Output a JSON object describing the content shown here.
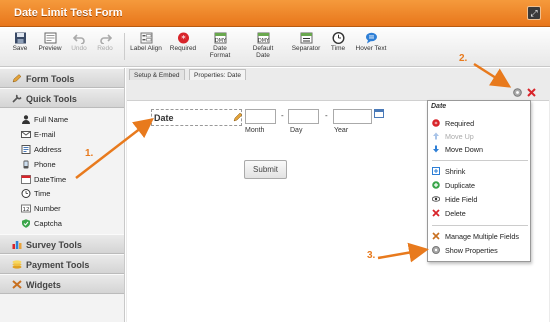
{
  "window": {
    "title": "Date Limit Test Form"
  },
  "toolbar": {
    "items": [
      {
        "label": "Save",
        "icon": "save-icon"
      },
      {
        "label": "Preview",
        "icon": "preview-icon"
      },
      {
        "label": "Undo",
        "icon": "undo-icon",
        "disabled": true
      },
      {
        "label": "Redo",
        "icon": "redo-icon",
        "disabled": true
      },
      {
        "label": "Label Align",
        "icon": "label-align-icon"
      },
      {
        "label": "Required",
        "icon": "required-icon"
      },
      {
        "label": "Date Format",
        "icon": "date-format-icon"
      },
      {
        "label": "Default Date",
        "icon": "default-date-icon"
      },
      {
        "label": "Separator",
        "icon": "separator-icon"
      },
      {
        "label": "Time",
        "icon": "clock-icon"
      },
      {
        "label": "Hover Text",
        "icon": "hover-text-icon"
      }
    ]
  },
  "sidebar": {
    "form_tools": "Form Tools",
    "quick_tools": "Quick Tools",
    "quick_items": [
      {
        "label": "Full Name",
        "icon": "person-icon"
      },
      {
        "label": "E-mail",
        "icon": "envelope-icon"
      },
      {
        "label": "Address",
        "icon": "address-icon"
      },
      {
        "label": "Phone",
        "icon": "phone-icon"
      },
      {
        "label": "DateTime",
        "icon": "calendar-icon"
      },
      {
        "label": "Time",
        "icon": "clock-icon"
      },
      {
        "label": "Number",
        "icon": "number-icon"
      },
      {
        "label": "Captcha",
        "icon": "shield-icon"
      }
    ],
    "survey_tools": "Survey Tools",
    "payment_tools": "Payment Tools",
    "widgets": "Widgets"
  },
  "tabs": {
    "setup": "Setup & Embed",
    "properties": "Properties: Date"
  },
  "form": {
    "field_label": "Date",
    "month_label": "Month",
    "day_label": "Day",
    "year_label": "Year",
    "dash": "-",
    "submit_label": "Submit"
  },
  "context_menu": {
    "title": "Date",
    "items": [
      {
        "label": "Required",
        "icon": "required-icon"
      },
      {
        "label": "Move Up",
        "icon": "arrow-up-icon",
        "disabled": true
      },
      {
        "label": "Move Down",
        "icon": "arrow-down-icon"
      },
      {
        "label": "Shrink",
        "icon": "shrink-icon"
      },
      {
        "label": "Duplicate",
        "icon": "duplicate-icon"
      },
      {
        "label": "Hide Field",
        "icon": "eye-icon"
      },
      {
        "label": "Delete",
        "icon": "delete-icon"
      },
      {
        "label": "Manage Multiple Fields",
        "icon": "manage-fields-icon"
      },
      {
        "label": "Show Properties",
        "icon": "gear-icon"
      }
    ]
  },
  "annotations": {
    "one": "1.",
    "two": "2.",
    "three": "3."
  },
  "colors": {
    "accent": "#f0862a",
    "annotation": "#e87a1d"
  }
}
